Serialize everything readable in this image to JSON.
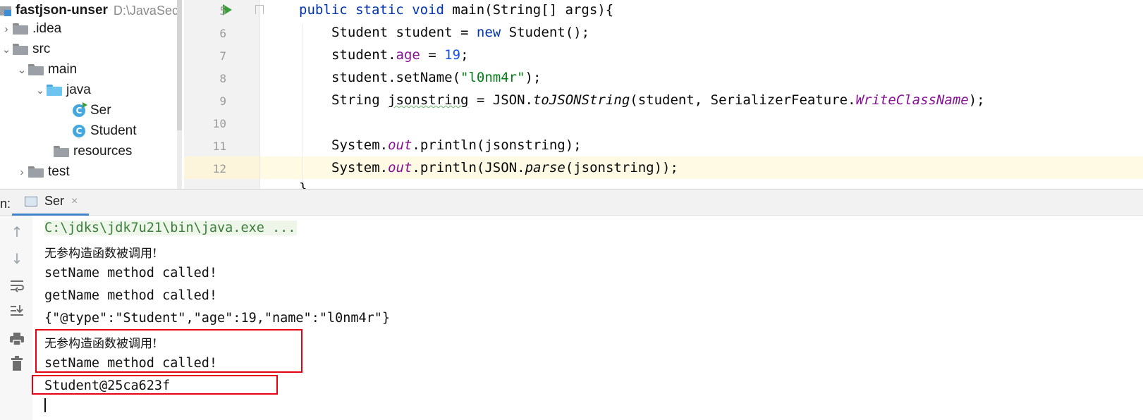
{
  "project_tree": {
    "root": {
      "name": "fastjson-unser",
      "path": "D:\\JavaSec\\f"
    },
    "items": [
      {
        "label": ".idea",
        "type": "folder",
        "expanded": false
      },
      {
        "label": "src",
        "type": "folder",
        "expanded": true
      },
      {
        "label": "main",
        "type": "folder",
        "expanded": true
      },
      {
        "label": "java",
        "type": "source-folder",
        "expanded": true
      },
      {
        "label": "Ser",
        "type": "class-runnable"
      },
      {
        "label": "Student",
        "type": "class"
      },
      {
        "label": "resources",
        "type": "resources-folder"
      },
      {
        "label": "test",
        "type": "folder",
        "expanded": false
      }
    ]
  },
  "editor": {
    "line_numbers": [
      "5",
      "6",
      "7",
      "8",
      "9",
      "10",
      "11",
      "12"
    ],
    "lines": {
      "l5": {
        "kw1": "public",
        "kw2": "static",
        "kw3": "void",
        "rest": " main(String[] args){"
      },
      "l6": {
        "a": "Student student = ",
        "kw": "new",
        "b": " Student();"
      },
      "l7": {
        "a": "student.",
        "field": "age",
        "b": " = ",
        "num": "19",
        "c": ";"
      },
      "l8": {
        "a": "student.setName(",
        "str": "\"l0nm4r\"",
        "b": ");"
      },
      "l9": {
        "a": "String ",
        "var": "jsonstring",
        "b": " = JSON.",
        "method": "toJSONString",
        "c": "(student, SerializerFeature.",
        "const": "WriteClassName",
        "d": ");"
      },
      "l11": {
        "a": "System.",
        "field": "out",
        "b": ".println(jsonstring);"
      },
      "l12": {
        "a": "System.",
        "field": "out",
        "b": ".println(JSON.",
        "method": "parse",
        "c": "(jsonstring));"
      }
    },
    "partial_last": "}"
  },
  "run_panel": {
    "label": "n:",
    "tab_label": "Ser",
    "close_icon": "×",
    "toolbar_icons": [
      "arrow-up-icon",
      "arrow-down-icon",
      "soft-wrap-icon",
      "scroll-to-end-icon",
      "print-icon",
      "trash-icon"
    ],
    "console_lines": [
      "C:\\jdks\\jdk7u21\\bin\\java.exe ...",
      "无参构造函数被调用!",
      "setName method called!",
      "getName method called!",
      "{\"@type\":\"Student\",\"age\":19,\"name\":\"l0nm4r\"}",
      "无参构造函数被调用!",
      "setName method called!",
      "Student@25ca623f"
    ],
    "highlight_color": "#e60012"
  }
}
